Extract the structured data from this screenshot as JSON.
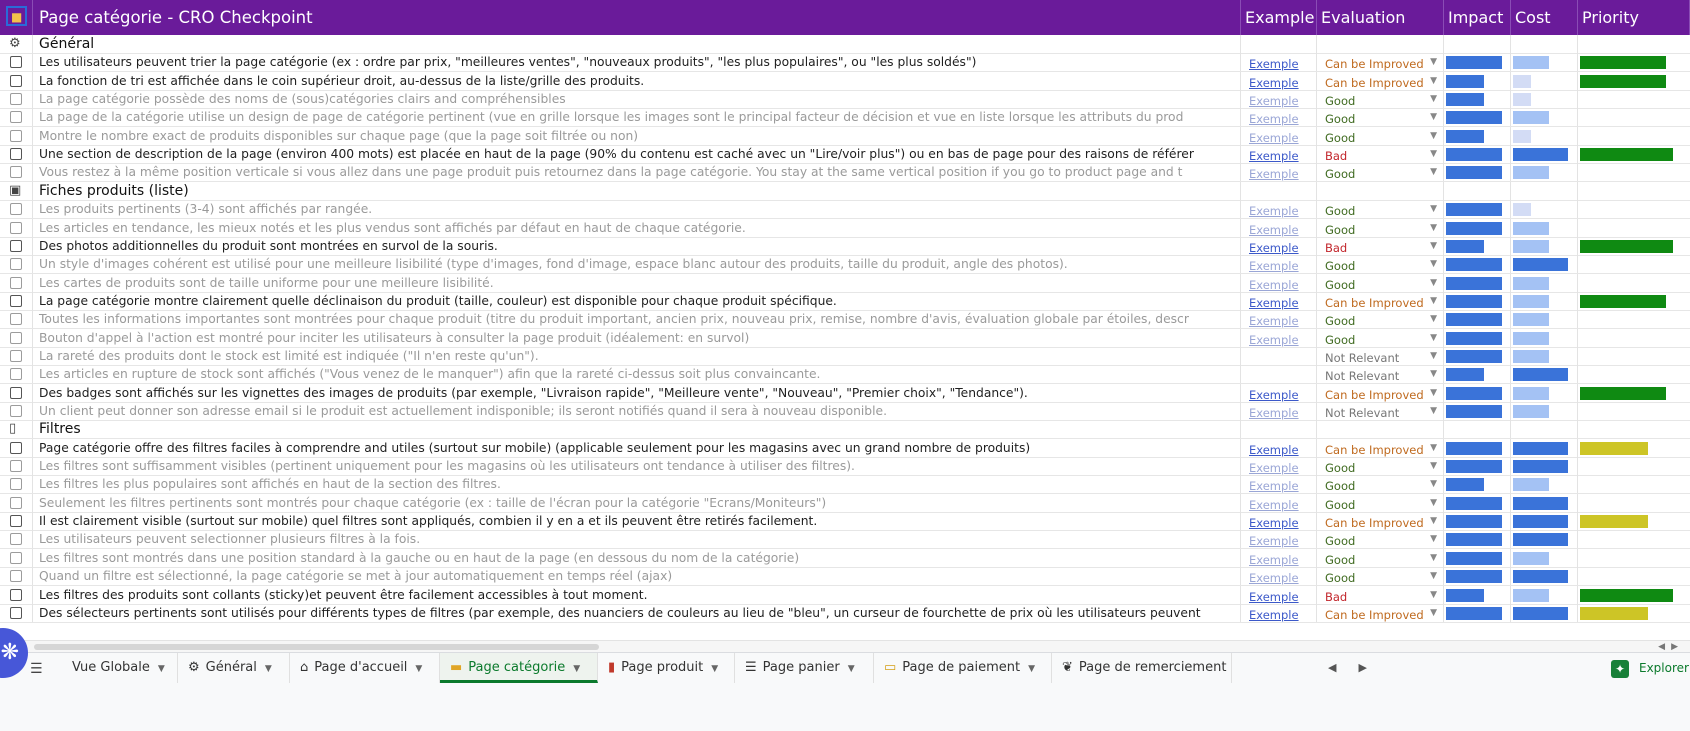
{
  "header": {
    "title": "Page catégorie - CRO Checkpoint",
    "col_example": "Example",
    "col_evaluation": "Evaluation",
    "col_impact": "Impact",
    "col_cost": "Cost",
    "col_priority": "Priority"
  },
  "colors": {
    "header_bg": "#6a1b9a",
    "impact_dark": "#3a73d9",
    "impact_light": "#a4c2f4",
    "cost_pale": "#d3dcf5",
    "priority_green": "#0f8a12",
    "priority_yellow": "#cdc526",
    "eval_improve": "#bf6a1f",
    "eval_good": "#3f6a20",
    "eval_bad": "#c2262c",
    "eval_notrelevant": "#777777"
  },
  "sections": [
    {
      "title": "Général",
      "icon": "gear-icon",
      "items": [
        {
          "text": "Les utilisateurs peuvent trier la page catégorie (ex : ordre par prix, \"meilleures ventes\", \"nouveaux produits\", \"les plus populaires\", ou \"les plus soldés\")",
          "muted": false,
          "example": "Exemple",
          "evaluation": "Can be Improved",
          "impact": 3,
          "cost": 2,
          "priority": 3
        },
        {
          "text": "La fonction de tri est affichée dans le coin supérieur droit, au-dessus de la liste/grille des produits.",
          "muted": false,
          "example": "Exemple",
          "evaluation": "Can be Improved",
          "impact": 2,
          "cost": 1,
          "priority": 3
        },
        {
          "text": "La page catégorie possède des noms de (sous)catégories clairs and compréhensibles",
          "muted": true,
          "example": "Exemple",
          "evaluation": "Good",
          "impact": 2,
          "cost": 1,
          "priority": 0
        },
        {
          "text": "La page de la catégorie utilise un design de page de catégorie pertinent (vue en grille lorsque les images sont le principal facteur de décision et vue en liste lorsque les attributs du prod",
          "muted": true,
          "example": "Exemple",
          "evaluation": "Good",
          "impact": 3,
          "cost": 2,
          "priority": 0
        },
        {
          "text": "Montre le nombre exact de produits disponibles sur chaque page (que la page soit filtrée ou non)",
          "muted": true,
          "example": "Exemple",
          "evaluation": "Good",
          "impact": 2,
          "cost": 1,
          "priority": 0
        },
        {
          "text": "Une section de description de la page (environ 400 mots)  est placée en haut de la page (90% du contenu est caché avec un \"Lire/voir plus\") ou en bas de page pour des raisons de référer",
          "muted": false,
          "example": "Exemple",
          "evaluation": "Bad",
          "impact": 3,
          "cost": 3,
          "priority": 4
        },
        {
          "text": "Vous restez à la même position verticale si vous allez dans une page produit puis retournez dans la page catégorie. You stay at the same vertical position if you go to product page and t",
          "muted": true,
          "example": "Exemple",
          "evaluation": "Good",
          "impact": 3,
          "cost": 2,
          "priority": 0
        }
      ]
    },
    {
      "title": "Fiches produits (liste)",
      "icon": "product-card-icon",
      "items": [
        {
          "text": "Les produits pertinents (3-4) sont affichés par rangée.",
          "muted": true,
          "example": "Exemple",
          "evaluation": "Good",
          "impact": 3,
          "cost": 1,
          "priority": 0
        },
        {
          "text": "Les articles en tendance, les mieux notés et les plus vendus sont affichés par défaut en haut de chaque catégorie.",
          "muted": true,
          "example": "Exemple",
          "evaluation": "Good",
          "impact": 3,
          "cost": 2,
          "priority": 0
        },
        {
          "text": "Des photos additionnelles du produit sont montrées en survol de la souris.",
          "muted": false,
          "example": "Exemple",
          "evaluation": "Bad",
          "impact": 2,
          "cost": 2,
          "priority": 4
        },
        {
          "text": "Un style d'images cohérent est utilisé pour une meilleure lisibilité (type d'images, fond d'image, espace blanc autour des produits, taille du produit, angle des photos).",
          "muted": true,
          "example": "Exemple",
          "evaluation": "Good",
          "impact": 3,
          "cost": 3,
          "priority": 0
        },
        {
          "text": "Les cartes de produits sont de taille uniforme pour une meilleure lisibilité.",
          "muted": true,
          "example": "Exemple",
          "evaluation": "Good",
          "impact": 3,
          "cost": 2,
          "priority": 0
        },
        {
          "text": "La page catégorie montre clairement quelle déclinaison du produit (taille, couleur) est disponible pour chaque produit spécifique.",
          "muted": false,
          "example": "Exemple",
          "evaluation": "Can be Improved",
          "impact": 3,
          "cost": 2,
          "priority": 3
        },
        {
          "text": "Toutes les informations importantes sont montrées pour chaque produit (titre du produit important, ancien prix, nouveau prix, remise, nombre d'avis, évaluation globale par étoiles, descr",
          "muted": true,
          "example": "Exemple",
          "evaluation": "Good",
          "impact": 3,
          "cost": 2,
          "priority": 0
        },
        {
          "text": "Bouton d'appel à l'action est montré pour inciter les utilisateurs à consulter la page produit (idéalement: en survol)",
          "muted": true,
          "example": "Exemple",
          "evaluation": "Good",
          "impact": 3,
          "cost": 2,
          "priority": 0
        },
        {
          "text": "La rareté des produits dont le stock est limité est indiquée (\"Il n'en reste qu'un\").",
          "muted": true,
          "example": "",
          "evaluation": "Not Relevant",
          "impact": 3,
          "cost": 2,
          "priority": 0
        },
        {
          "text": "Les articles en rupture de stock sont affichés (\"Vous venez de le manquer\") afin que la rareté ci-dessus soit plus convaincante.",
          "muted": true,
          "example": "",
          "evaluation": "Not Relevant",
          "impact": 2,
          "cost": 3,
          "priority": 0
        },
        {
          "text": "Des badges sont affichés sur les vignettes des images de produits (par exemple, \"Livraison rapide\", \"Meilleure vente\", \"Nouveau\", \"Premier choix\", \"Tendance\").",
          "muted": false,
          "example": "Exemple",
          "evaluation": "Can be Improved",
          "impact": 3,
          "cost": 2,
          "priority": 3
        },
        {
          "text": "Un client peut donner son adresse email si le produit est actuellement indisponible; ils seront notifiés quand il sera à nouveau disponible.",
          "muted": true,
          "example": "Exemple",
          "evaluation": "Not Relevant",
          "impact": 3,
          "cost": 2,
          "priority": 0
        }
      ]
    },
    {
      "title": "Filtres",
      "icon": "filter-icon",
      "items": [
        {
          "text": "Page catégorie offre des filtres faciles à comprendre and utiles (surtout sur mobile) (applicable seulement pour les magasins avec un grand nombre de produits)",
          "muted": false,
          "example": "Exemple",
          "evaluation": "Can be Improved",
          "impact": 3,
          "cost": 3,
          "priority": 2
        },
        {
          "text": "Les filtres sont suffisamment visibles (pertinent uniquement pour les magasins où les utilisateurs ont tendance à utiliser des filtres).",
          "muted": true,
          "example": "Exemple",
          "evaluation": "Good",
          "impact": 3,
          "cost": 3,
          "priority": 0
        },
        {
          "text": "Les filtres les plus populaires sont affichés en haut de la section des filtres.",
          "muted": true,
          "example": "Exemple",
          "evaluation": "Good",
          "impact": 2,
          "cost": 2,
          "priority": 0
        },
        {
          "text": "Seulement les filtres pertinents sont montrés pour chaque catégorie (ex : taille de l'écran pour la catégorie \"Ecrans/Moniteurs\")",
          "muted": true,
          "example": "Exemple",
          "evaluation": "Good",
          "impact": 3,
          "cost": 3,
          "priority": 0
        },
        {
          "text": "Il est clairement visible (surtout sur mobile) quel filtres sont appliqués, combien il y en a et ils peuvent être retirés facilement.",
          "muted": false,
          "example": "Exemple",
          "evaluation": "Can be Improved",
          "impact": 3,
          "cost": 3,
          "priority": 2
        },
        {
          "text": "Les utilisateurs peuvent selectionner plusieurs filtres à la fois.",
          "muted": true,
          "example": "Exemple",
          "evaluation": "Good",
          "impact": 3,
          "cost": 3,
          "priority": 0
        },
        {
          "text": "Les filtres sont montrés dans une position standard à la gauche ou en haut de la page (en dessous du nom de la catégorie)",
          "muted": true,
          "example": "Exemple",
          "evaluation": "Good",
          "impact": 3,
          "cost": 2,
          "priority": 0
        },
        {
          "text": "Quand un filtre est sélectionné, la page catégorie se met à jour automatiquement en temps réel (ajax)",
          "muted": true,
          "example": "Exemple",
          "evaluation": "Good",
          "impact": 3,
          "cost": 3,
          "priority": 0
        },
        {
          "text": "Les filtres des produits sont collants (sticky)et peuvent être facilement accessibles à tout moment.",
          "muted": false,
          "example": "Exemple",
          "evaluation": "Bad",
          "impact": 2,
          "cost": 2,
          "priority": 4
        },
        {
          "text": "Des sélecteurs pertinents sont utilisés pour différents types de filtres (par exemple, des nuanciers de couleurs au lieu de \"bleu\", un curseur de fourchette de prix où les utilisateurs peuvent",
          "muted": false,
          "example": "Exemple",
          "evaluation": "Can be Improved",
          "impact": 3,
          "cost": 3,
          "priority": 2
        }
      ]
    }
  ],
  "tabs": [
    {
      "label": "Vue Globale",
      "icon": "",
      "active": false
    },
    {
      "label": "Général",
      "icon": "gear-icon",
      "active": false
    },
    {
      "label": "Page d'accueil",
      "icon": "home-icon",
      "active": false
    },
    {
      "label": "Page catégorie",
      "icon": "folder-icon",
      "active": true
    },
    {
      "label": "Page produit",
      "icon": "lipstick-icon",
      "active": false
    },
    {
      "label": "Page panier",
      "icon": "cart-icon",
      "active": false
    },
    {
      "label": "Page de paiement",
      "icon": "credit-card-icon",
      "active": false
    },
    {
      "label": "Page de remerciement",
      "icon": "praying-hands-icon",
      "active": false
    }
  ],
  "explore_label": "Explorer"
}
